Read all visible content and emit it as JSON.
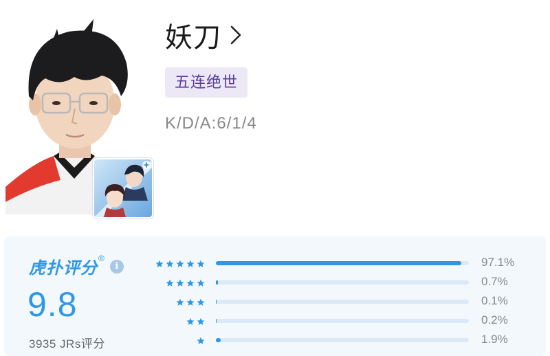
{
  "player": {
    "name": "妖刀",
    "tag": "五连绝世",
    "kda": "K/D/A:6/1/4"
  },
  "rating": {
    "brand": "虎扑评分",
    "brand_mark": "®",
    "score": "9.8",
    "count_text": "3935 JRs评分",
    "distribution": [
      {
        "stars": 5,
        "percent": 97.1,
        "label": "97.1%"
      },
      {
        "stars": 4,
        "percent": 0.7,
        "label": "0.7%"
      },
      {
        "stars": 3,
        "percent": 0.1,
        "label": "0.1%"
      },
      {
        "stars": 2,
        "percent": 0.2,
        "label": "0.2%"
      },
      {
        "stars": 1,
        "percent": 1.9,
        "label": "1.9%"
      }
    ]
  },
  "colors": {
    "accent": "#2e97e6",
    "tag_bg": "#ede8f6",
    "tag_text": "#5a3e97",
    "track": "#dbe8f5",
    "panel_bg": "#f3f8fd",
    "info": "#a6c8ea"
  },
  "icons": {
    "chevron": "chevron-right-icon",
    "info": "info-icon",
    "star": "star-icon"
  }
}
